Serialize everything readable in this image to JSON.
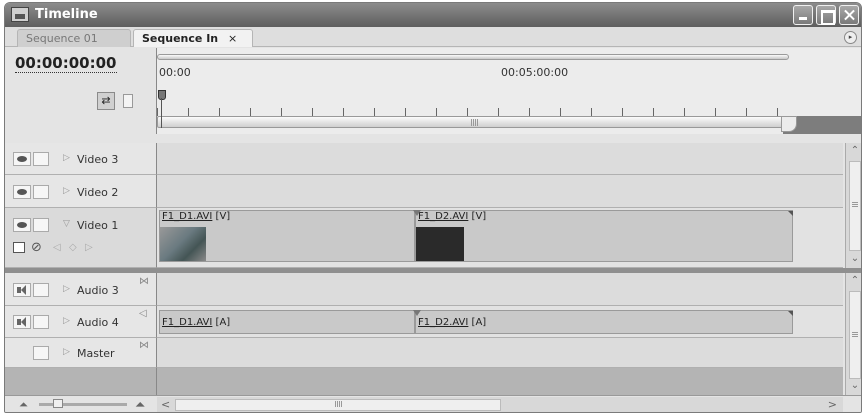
{
  "window": {
    "title": "Timeline",
    "buttons": [
      "minimize",
      "maximize",
      "close"
    ]
  },
  "tabs": [
    {
      "label": "Sequence 01",
      "active": false
    },
    {
      "label": "Sequence In",
      "active": true,
      "close": "×"
    }
  ],
  "panel_menu_glyph": "▸",
  "timecode": "00:00:00:00",
  "ruler": {
    "labels": [
      "00:00",
      "00:05:00:00"
    ]
  },
  "video_tracks": [
    {
      "name": "Video 3",
      "twirl": "▷"
    },
    {
      "name": "Video 2",
      "twirl": "▷"
    },
    {
      "name": "Video 1",
      "twirl": "▽"
    }
  ],
  "audio_tracks": [
    {
      "name": "Audio 3",
      "twirl": "▷",
      "bowtie": "⋈"
    },
    {
      "name": "Audio 4",
      "twirl": "▷",
      "bowtie": "◁"
    },
    {
      "name": "Master",
      "twirl": "▷",
      "bowtie": "⋈"
    }
  ],
  "clips": {
    "video1_a": {
      "name": "F1_D1.AVI",
      "suffix": " [V]"
    },
    "video1_b": {
      "name": "F1_D2.AVI",
      "suffix": " [V]"
    },
    "audio4_a": {
      "name": "F1_D1.AVI",
      "suffix": " [A]"
    },
    "audio4_b": {
      "name": "F1_D2.AVI",
      "suffix": " [A]"
    }
  },
  "icons": {
    "eye": "eye-icon",
    "speaker": "speaker-icon",
    "snap": "snap-icon",
    "marker": "marker-icon",
    "keyframe_prev": "◁",
    "keyframe_add": "◇",
    "keyframe_next": "▷",
    "zoom_out": "⏶",
    "zoom_in": "⏶",
    "scroll_left": "<",
    "scroll_right": ">",
    "scroll_up": "^",
    "scroll_down": "v"
  }
}
